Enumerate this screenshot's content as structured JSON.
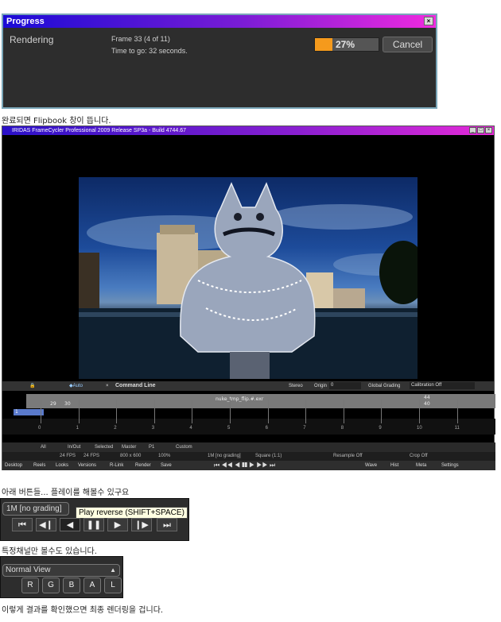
{
  "progress": {
    "title": "Progress",
    "status_label": "Rendering",
    "frame_text": "Frame 33 (4 of 11)",
    "time_text": "Time to go: 32 seconds.",
    "percent_text": "27%",
    "percent": 27,
    "cancel_label": "Cancel",
    "close_glyph": "×"
  },
  "captions": {
    "c1": "완료되면 Flipbook 창이 뜹니다.",
    "c2": "아래 버튼들... 플레이를 해볼수 있구요",
    "c3": "특정채널만 볼수도 있습니다.",
    "c4": "이렇게 결과를 확인했으면 최종 렌더링을 겁니다."
  },
  "framecycler": {
    "title": "IRIDAS FrameCycler Professional 2009 Release SP3a - Build 4744.67",
    "toolbar": {
      "auto": "Auto",
      "command_line": "Command Line",
      "stereo": "Stereo",
      "origin": "Origin",
      "origin_value": "0",
      "global_grading": "Global Grading",
      "calibration": "Calibration Off"
    },
    "timeline": {
      "clip_name": "nuke_tmp_flip.#.exr",
      "start_a": "29",
      "start_b": "30",
      "end_a": "44",
      "end_b": "40",
      "left_num": "1",
      "right_num": "11",
      "ticks": [
        "0",
        "1",
        "2",
        "3",
        "4",
        "5",
        "6",
        "7",
        "8",
        "9",
        "10",
        "11"
      ]
    },
    "tabs": [
      "All",
      "In/Out",
      "Selected",
      "Master",
      "P1",
      "Custom"
    ],
    "status": {
      "fps1": "24 FPS",
      "fps2": "24 FPS",
      "resolution": "800 x 600",
      "zoom": "100%",
      "grading": "1M [no grading]",
      "square": "Square (1:1)",
      "resample": "Resample Off",
      "crop": "Crop Off"
    },
    "bottom_left": [
      "Desktop",
      "Reels",
      "Looks",
      "Versions",
      "R-Link",
      "Render",
      "Save"
    ],
    "bottom_right": [
      "Wave",
      "Hist",
      "Meta",
      "Settings"
    ]
  },
  "crop1": {
    "grading_label": "1M [no grading]",
    "tooltip": "Play reverse (SHIFT+SPACE)",
    "controls": [
      "first-frame",
      "step-back",
      "play-reverse",
      "pause",
      "play",
      "step-forward",
      "last-frame"
    ]
  },
  "crop2": {
    "view_label": "Normal View",
    "channels": [
      "R",
      "G",
      "B",
      "A",
      "L"
    ]
  },
  "colors": {
    "progress_fill": "#f59a1c",
    "title_gradient_start": "#1a0bd6",
    "title_gradient_end": "#f02adf"
  }
}
